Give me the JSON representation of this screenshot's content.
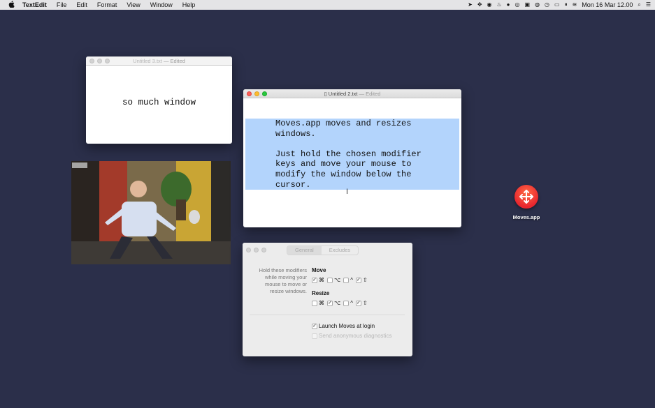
{
  "menubar": {
    "apple": "",
    "app_name": "TextEdit",
    "items": [
      "File",
      "Edit",
      "Format",
      "View",
      "Window",
      "Help"
    ],
    "clock": "Mon 16 Mar  12.00",
    "status_icons": [
      "location-icon",
      "moves-icon",
      "record-icon",
      "flame-icon",
      "dot-icon",
      "target-icon",
      "toolbox-icon",
      "eye-icon",
      "history-icon",
      "battery-icon",
      "pause-icon",
      "wifi-icon",
      "search-icon",
      "menu-icon"
    ]
  },
  "windows": {
    "untitled3": {
      "title": "Untitled 3.txt",
      "edited": "— Edited",
      "body": "so much window"
    },
    "untitled2": {
      "title": "Untitled 2.txt",
      "edited": "— Edited",
      "body": "Moves.app moves and resizes\nwindows.\n\nJust hold the chosen modifier\nkeys and move your mouse to\nmodify the window below the\ncursor."
    },
    "prefs": {
      "tabs": [
        "General",
        "Excludes"
      ],
      "description": "Hold these modifiers while moving your mouse to move or resize windows.",
      "move_label": "Move",
      "resize_label": "Resize",
      "move_keys": [
        {
          "symbol": "⌘",
          "checked": true
        },
        {
          "symbol": "⌥",
          "checked": false
        },
        {
          "symbol": "^",
          "checked": false
        },
        {
          "symbol": "⇧",
          "checked": true
        }
      ],
      "resize_keys": [
        {
          "symbol": "⌘",
          "checked": false
        },
        {
          "symbol": "⌥",
          "checked": true
        },
        {
          "symbol": "^",
          "checked": false
        },
        {
          "symbol": "⇧",
          "checked": true
        }
      ],
      "launch_at_login": "Launch Moves at login",
      "launch_checked": true,
      "send_diagnostics": "Send anonymous diagnostics",
      "diagnostics_checked": false
    }
  },
  "desktop": {
    "app_label": "Moves.app"
  },
  "gif": {
    "watermark": "BBC"
  },
  "colors": {
    "desktop": "#2b2f4a",
    "selection": "#b3d4fc",
    "app_icon": "#e8262e"
  }
}
